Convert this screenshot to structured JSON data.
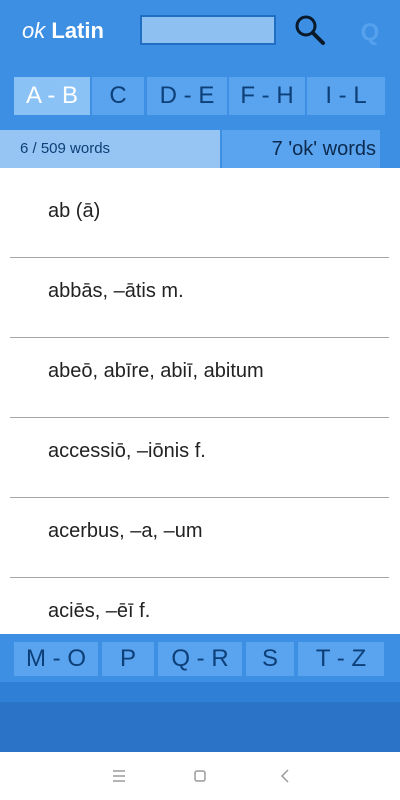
{
  "app": {
    "logo_prefix": "ok",
    "logo_name": "Latin"
  },
  "search": {
    "value": "",
    "placeholder": ""
  },
  "q_label": "Q",
  "top_tabs": [
    "A - B",
    "C",
    "D - E",
    "F - H",
    "I - L"
  ],
  "active_tab": "A - B",
  "counts": {
    "progress": "6 / 509 words",
    "ok_words": "7 'ok' words"
  },
  "words": [
    "ab (ā)",
    "abbās, –ātis m.",
    "abeō, abīre, abiī, abitum",
    "accessiō, –iōnis f.",
    "acerbus, –a, –um",
    "aciēs, –ēī f."
  ],
  "bottom_tabs": [
    "M - O",
    "P",
    "Q - R",
    "S",
    "T - Z"
  ],
  "colors": {
    "primary": "#3d8fe3",
    "tab": "#5aa3ee",
    "tab_active": "#8bc2f6",
    "text_dark": "#0d3f78"
  },
  "icons": {
    "search": "search-icon",
    "menu": "menu-icon",
    "home": "home-icon",
    "back": "back-icon"
  }
}
